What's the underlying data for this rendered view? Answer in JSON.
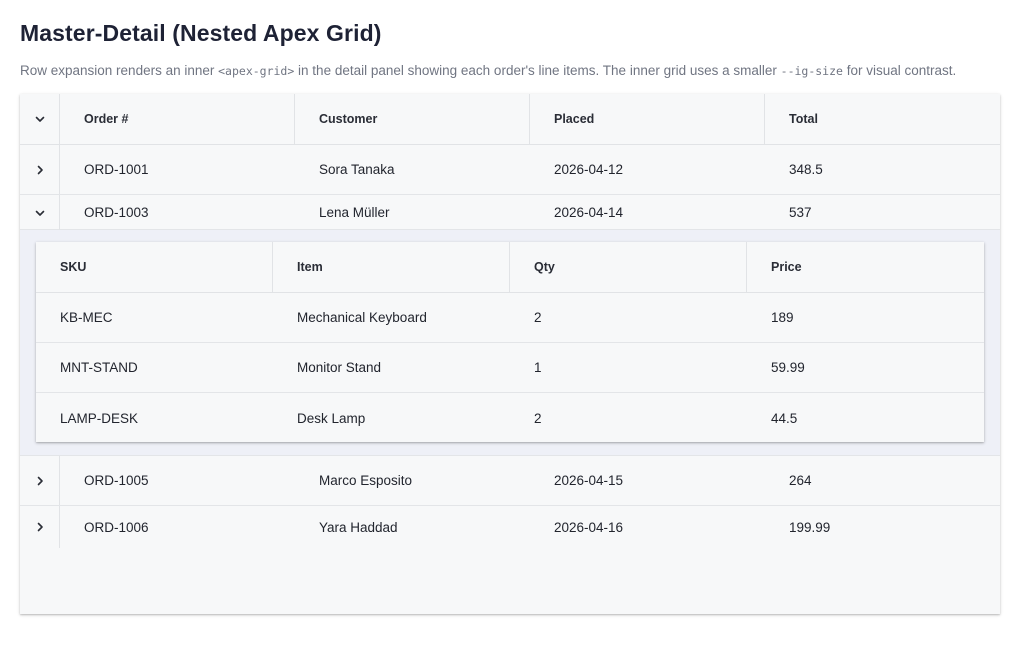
{
  "page": {
    "title": "Master-Detail (Nested Apex Grid)",
    "subtitle": {
      "part1": "Row expansion renders an inner ",
      "code1": "<apex-grid>",
      "part2": " in the detail panel showing each order's line items. The inner grid uses a smaller ",
      "code2": "--ig-size",
      "part3": " for visual contrast."
    }
  },
  "grid": {
    "columns": [
      "Order #",
      "Customer",
      "Placed",
      "Total"
    ],
    "header_toggle_icon": "chevron-down-icon",
    "rows": [
      {
        "order": "ORD-1001",
        "customer": "Sora Tanaka",
        "placed": "2026-04-12",
        "total": "348.5",
        "expanded": false
      },
      {
        "order": "ORD-1003",
        "customer": "Lena Müller",
        "placed": "2026-04-14",
        "total": "537",
        "expanded": true
      },
      {
        "order": "ORD-1005",
        "customer": "Marco Esposito",
        "placed": "2026-04-15",
        "total": "264",
        "expanded": false
      },
      {
        "order": "ORD-1006",
        "customer": "Yara Haddad",
        "placed": "2026-04-16",
        "total": "199.99",
        "expanded": false
      }
    ],
    "detail": {
      "columns": [
        "SKU",
        "Item",
        "Qty",
        "Price"
      ],
      "rows": [
        {
          "sku": "KB-MEC",
          "item": "Mechanical Keyboard",
          "qty": "2",
          "price": "189"
        },
        {
          "sku": "MNT-STAND",
          "item": "Monitor Stand",
          "qty": "1",
          "price": "59.99"
        },
        {
          "sku": "LAMP-DESK",
          "item": "Desk Lamp",
          "qty": "2",
          "price": "44.5"
        }
      ]
    }
  },
  "colors": {
    "title": "#1e2235",
    "muted_text": "#707582",
    "grid_background": "#f7f8f9",
    "detail_background": "#eef0f7",
    "border": "#e1e3e6"
  }
}
